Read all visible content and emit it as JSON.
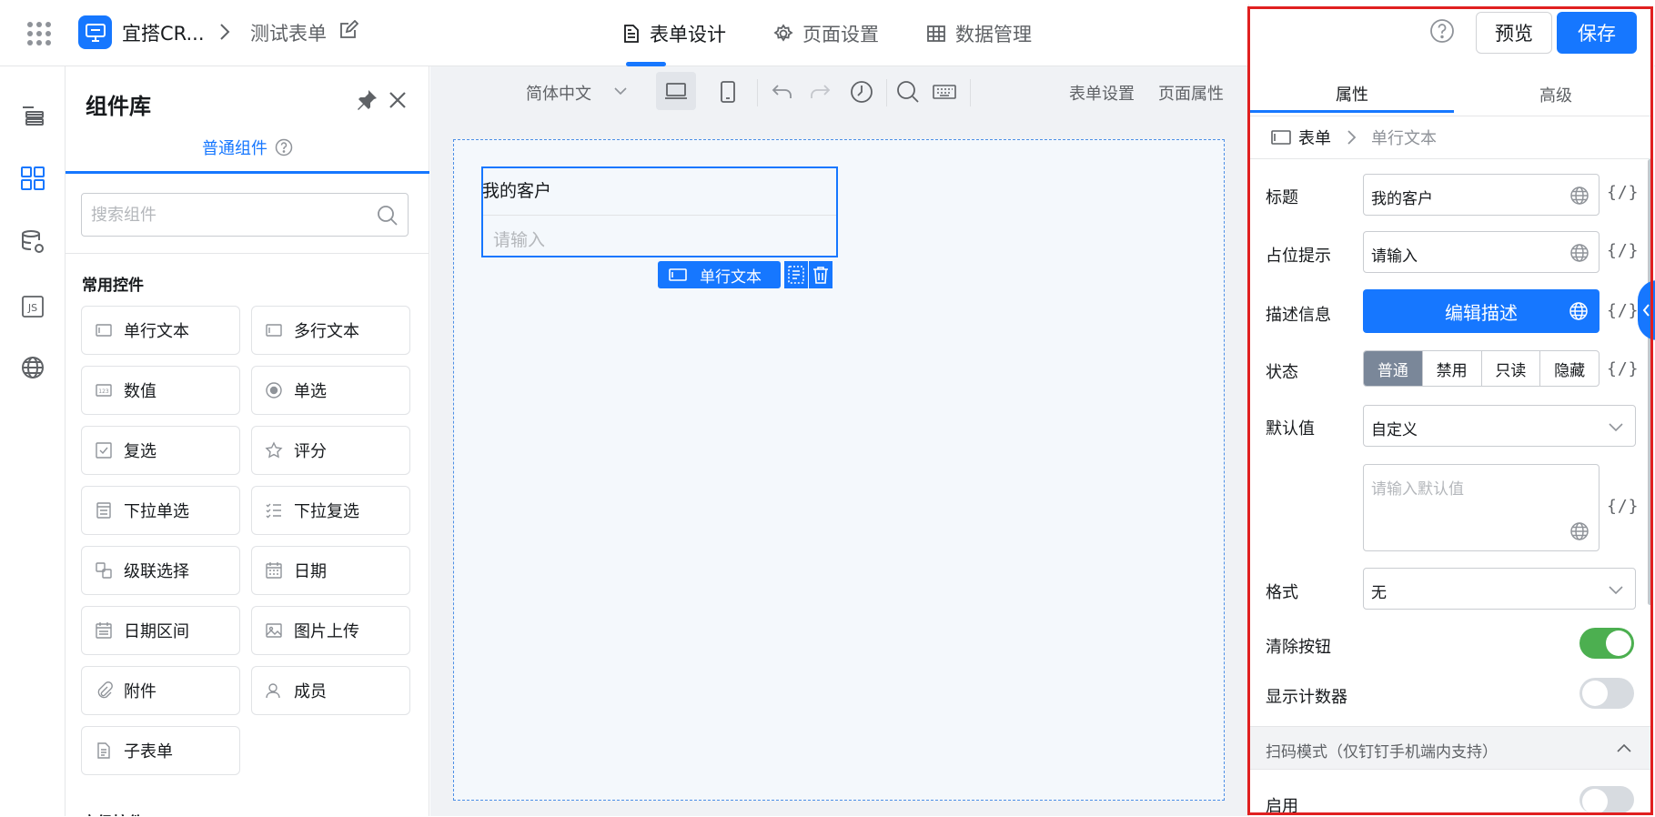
{
  "header": {
    "app_name": "宜搭CR...",
    "form_name": "测试表单",
    "tabs": [
      {
        "label": "表单设计",
        "icon": "document-icon",
        "active": true
      },
      {
        "label": "页面设置",
        "icon": "gear-icon",
        "active": false
      },
      {
        "label": "数据管理",
        "icon": "table-icon",
        "active": false
      }
    ],
    "accent": "#1677ff"
  },
  "rail": {
    "items": [
      "outline-icon",
      "components-icon",
      "datasource-icon",
      "js-icon",
      "globe-icon"
    ],
    "js_label": "JS"
  },
  "library": {
    "title": "组件库",
    "tab": "普通组件",
    "search_placeholder": "搜索组件",
    "section": "常用控件",
    "components": [
      {
        "label": "单行文本",
        "icon": "single-line-text-icon"
      },
      {
        "label": "多行文本",
        "icon": "multi-line-text-icon"
      },
      {
        "label": "数值",
        "icon": "number-icon"
      },
      {
        "label": "单选",
        "icon": "radio-icon"
      },
      {
        "label": "复选",
        "icon": "checkbox-icon"
      },
      {
        "label": "评分",
        "icon": "star-icon"
      },
      {
        "label": "下拉单选",
        "icon": "dropdown-icon"
      },
      {
        "label": "下拉复选",
        "icon": "dropdown-multi-icon"
      },
      {
        "label": "级联选择",
        "icon": "cascade-icon"
      },
      {
        "label": "日期",
        "icon": "calendar-icon"
      },
      {
        "label": "日期区间",
        "icon": "date-range-icon"
      },
      {
        "label": "图片上传",
        "icon": "image-icon"
      },
      {
        "label": "附件",
        "icon": "paperclip-icon"
      },
      {
        "label": "成员",
        "icon": "user-icon"
      },
      {
        "label": "子表单",
        "icon": "subform-icon"
      }
    ],
    "next_section_partial": "高级控件"
  },
  "toolbar": {
    "language": "简体中文",
    "form_settings": "表单设置",
    "page_props": "页面属性"
  },
  "canvas": {
    "field_title": "我的客户",
    "field_placeholder": "请输入",
    "selected_tag": "单行文本"
  },
  "panel": {
    "preview": "预览",
    "save": "保存",
    "tabs": [
      "属性",
      "高级"
    ],
    "breadcrumb": {
      "root": "表单",
      "current": "单行文本"
    },
    "var_token": "{/}",
    "fields": {
      "title_label": "标题",
      "title_value": "我的客户",
      "placeholder_label": "占位提示",
      "placeholder_value": "请输入",
      "desc_label": "描述信息",
      "desc_button": "编辑描述",
      "state_label": "状态",
      "state_options": [
        "普通",
        "禁用",
        "只读",
        "隐藏"
      ],
      "state_selected": "普通",
      "default_label": "默认值",
      "default_mode": "自定义",
      "default_placeholder": "请输入默认值",
      "format_label": "格式",
      "format_value": "无",
      "clear_label": "清除按钮",
      "clear_on": true,
      "counter_label": "显示计数器",
      "counter_on": false,
      "scan_section": "扫码模式（仅钉钉手机端内支持）",
      "enable_label": "启用",
      "enable_on": false
    },
    "highlight_color": "#e02020"
  }
}
